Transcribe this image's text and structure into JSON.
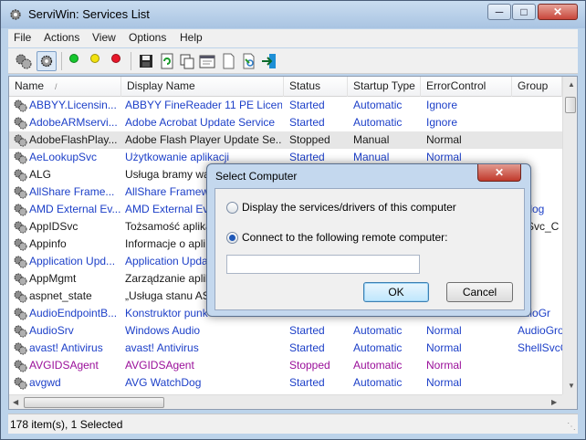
{
  "window": {
    "title": "ServiWin: Services List"
  },
  "menu": [
    "File",
    "Actions",
    "View",
    "Options",
    "Help"
  ],
  "toolbar": {
    "buttons": [
      "services-icon",
      "drivers-icon",
      "start-green-icon",
      "pause-yellow-icon",
      "stop-red-icon",
      "save-icon",
      "refresh-icon",
      "copy-icon",
      "properties-icon",
      "html-report-icon",
      "find-icon",
      "exit-icon"
    ],
    "colors": {
      "green": "#16c72e",
      "yellow": "#f2e20f",
      "red": "#e8172a"
    }
  },
  "list": {
    "columns": [
      "Name",
      "Display Name",
      "Status",
      "Startup Type",
      "ErrorControl",
      "Group"
    ],
    "sort_indicator": "/",
    "colors": {
      "stopped": "#1a1a1a",
      "running": "#1c3fc8",
      "disabled": "#9a0f9a"
    },
    "rows": [
      {
        "name": "ABBYY.Licensin...",
        "display": "ABBYY FineReader 11 PE Licen...",
        "status": "Started",
        "startup": "Automatic",
        "error": "Ignore",
        "group": "",
        "color": "running"
      },
      {
        "name": "AdobeARMservi...",
        "display": "Adobe Acrobat Update Service",
        "status": "Started",
        "startup": "Automatic",
        "error": "Ignore",
        "group": "",
        "color": "running"
      },
      {
        "name": "AdobeFlashPlay...",
        "display": "Adobe Flash Player Update Se...",
        "status": "Stopped",
        "startup": "Manual",
        "error": "Normal",
        "group": "",
        "color": "stopped",
        "selected": true
      },
      {
        "name": "AeLookupSvc",
        "display": "Użytkowanie aplikacji",
        "status": "Started",
        "startup": "Manual",
        "error": "Normal",
        "group": "",
        "color": "running"
      },
      {
        "name": "ALG",
        "display": "Usługa bramy wa",
        "status": "",
        "startup": "",
        "error": "",
        "group": "",
        "color": "stopped"
      },
      {
        "name": "AllShare Frame...",
        "display": "AllShare Framewo",
        "status": "",
        "startup": "",
        "error": "",
        "group": "",
        "color": "running"
      },
      {
        "name": "AMD External Ev...",
        "display": "AMD External Eve",
        "status": "",
        "startup": "",
        "error": "",
        "group": "nt log",
        "color": "running"
      },
      {
        "name": "AppIDSvc",
        "display": "Tożsamość aplika",
        "status": "",
        "startup": "",
        "error": "",
        "group": "efSvc_C",
        "color": "stopped"
      },
      {
        "name": "Appinfo",
        "display": "Informacje o apli",
        "status": "",
        "startup": "",
        "error": "",
        "group": "",
        "color": "stopped"
      },
      {
        "name": "Application Upd...",
        "display": "Application Upda",
        "status": "",
        "startup": "",
        "error": "",
        "group": "",
        "color": "running"
      },
      {
        "name": "AppMgmt",
        "display": "Zarządzanie aplik",
        "status": "",
        "startup": "",
        "error": "",
        "group": "",
        "color": "stopped"
      },
      {
        "name": "aspnet_state",
        "display": "„Usługa stanu AS",
        "status": "",
        "startup": "",
        "error": "",
        "group": "",
        "color": "stopped"
      },
      {
        "name": "AudioEndpointB...",
        "display": "Konstruktor punk",
        "status": "",
        "startup": "",
        "error": "",
        "group": "udioGr",
        "color": "running"
      },
      {
        "name": "AudioSrv",
        "display": "Windows Audio",
        "status": "Started",
        "startup": "Automatic",
        "error": "Normal",
        "group": "AudioGro",
        "color": "running"
      },
      {
        "name": "avast! Antivirus",
        "display": "avast! Antivirus",
        "status": "Started",
        "startup": "Automatic",
        "error": "Normal",
        "group": "ShellSvcG",
        "color": "running"
      },
      {
        "name": "AVGIDSAgent",
        "display": "AVGIDSAgent",
        "status": "Stopped",
        "startup": "Automatic",
        "error": "Normal",
        "group": "",
        "color": "disabled"
      },
      {
        "name": "avgwd",
        "display": "AVG WatchDog",
        "status": "Started",
        "startup": "Automatic",
        "error": "Normal",
        "group": "",
        "color": "running"
      }
    ]
  },
  "status_bar": {
    "text": "178 item(s), 1 Selected"
  },
  "dialog": {
    "title": "Select Computer",
    "option_local": "Display the services/drivers of this computer",
    "option_remote": "Connect to the following remote computer:",
    "selected_option": "remote",
    "remote_computer_value": "",
    "ok_label": "OK",
    "cancel_label": "Cancel"
  }
}
